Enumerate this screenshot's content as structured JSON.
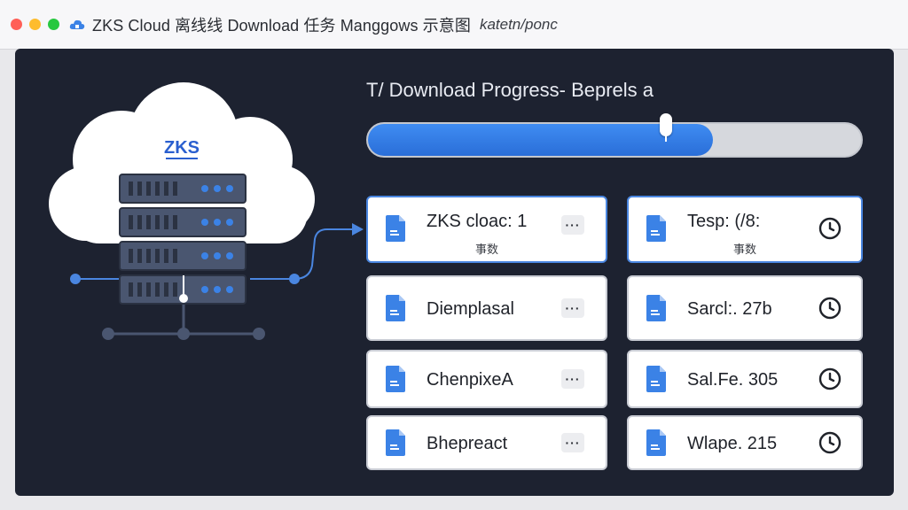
{
  "window": {
    "title": "ZKS Cloud 离线线 Download 任务  Manggows 示意图",
    "path": "katetn/ponc"
  },
  "illustration": {
    "cloud_label": "ZKS"
  },
  "progress": {
    "label": "T/  Download Progress- Beprels a",
    "value_fraction": 0.7
  },
  "tasks_left": [
    {
      "label": "ZKS cloac: 1",
      "sub": "事数",
      "action": "···"
    },
    {
      "label": "Diemplasal",
      "sub": "",
      "action": "···"
    },
    {
      "label": "ChenpixeA",
      "sub": "",
      "action": "···"
    },
    {
      "label": "Bhepreact",
      "sub": "",
      "action": "···"
    }
  ],
  "tasks_right": [
    {
      "label": "Tesp: (/8:",
      "sub": "事数",
      "status": "clock-icon"
    },
    {
      "label": "Sarcl:. 27b",
      "sub": "",
      "status": "clock-icon"
    },
    {
      "label": "Sal.Fe. 305",
      "sub": "",
      "status": "clock-icon"
    },
    {
      "label": "Wlape. 215",
      "sub": "",
      "status": "clock-icon"
    }
  ],
  "colors": {
    "accent": "#2f7ce8",
    "panel": "#1d2230",
    "server": "#4a5670"
  }
}
